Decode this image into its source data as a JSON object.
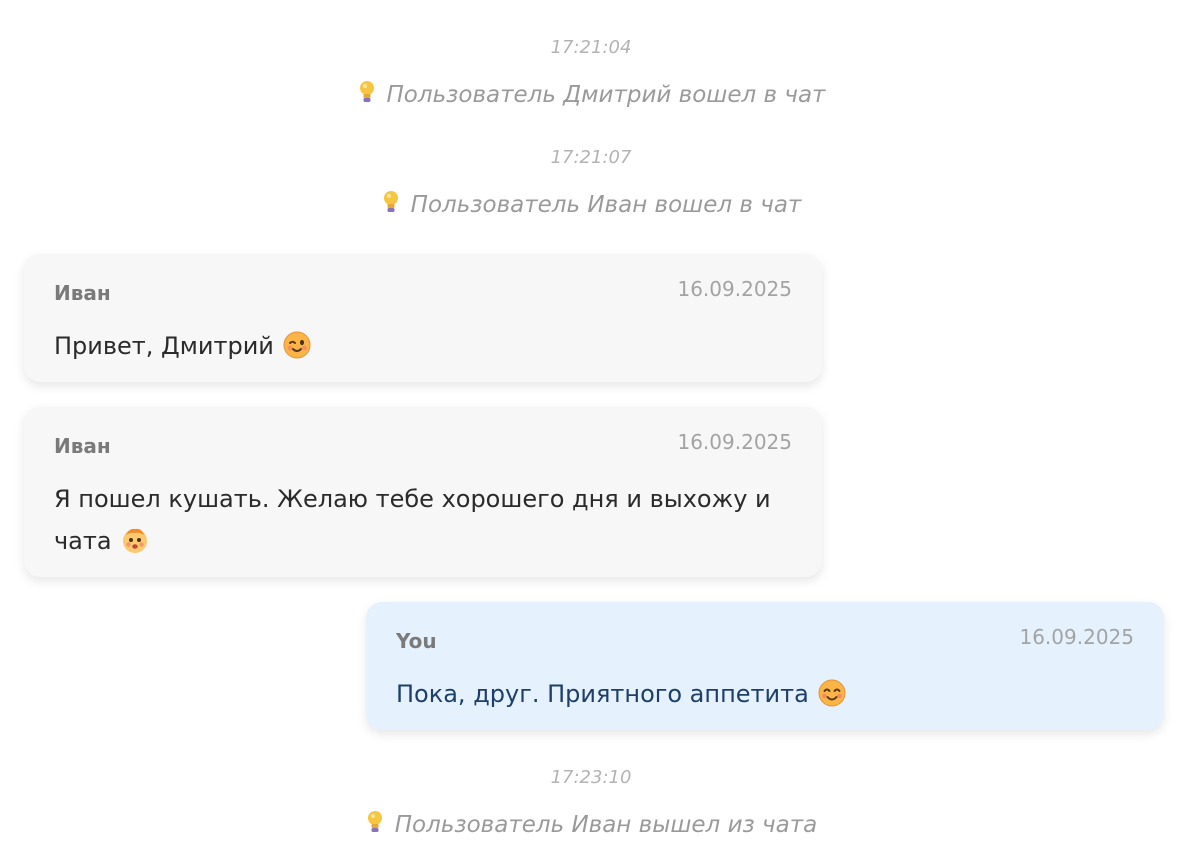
{
  "events": [
    {
      "time": "17:21:04",
      "text": "Пользователь Дмитрий вошел в чат",
      "icon": "lightbulb-icon"
    },
    {
      "time": "17:21:07",
      "text": "Пользователь Иван вошел в чат",
      "icon": "lightbulb-icon"
    },
    {
      "time": "17:23:10",
      "text": "Пользователь Иван вышел из чата",
      "icon": "lightbulb-icon"
    }
  ],
  "messages": [
    {
      "author": "Иван",
      "date": "16.09.2025",
      "text": "Привет, Дмитрий",
      "emoji": "winking-face-icon",
      "direction": "incoming"
    },
    {
      "author": "Иван",
      "date": "16.09.2025",
      "text": "Я пошел кушать. Желаю тебе хорошего дня и выхожу и чата",
      "emoji": "smiling-face-icon",
      "direction": "incoming"
    },
    {
      "author": "You",
      "date": "16.09.2025",
      "text": "Пока, друг. Приятного аппетита",
      "emoji": "smiling-face-with-smiling-eyes-icon",
      "direction": "outgoing"
    }
  ],
  "colors": {
    "incoming_bubble": "#f7f7f7",
    "outgoing_bubble": "#e5f1fd",
    "outgoing_text": "#1d3f69",
    "system_text": "#9a9a9a"
  }
}
